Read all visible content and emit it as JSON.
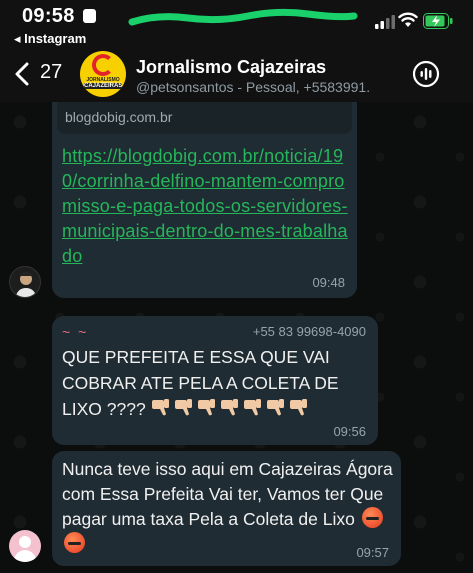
{
  "status_bar": {
    "time": "09:58",
    "back_app_label": "◂ Instagram"
  },
  "header": {
    "unread_count": "27",
    "contact_name": "Jornalismo Cajazeiras",
    "contact_subtitle": "@petsonsantos - Pessoal, +5583991...",
    "avatar_text_top": "JORNALISMO",
    "avatar_text_bottom": "CAJAZEIRAS"
  },
  "messages": [
    {
      "link_domain": "blogdobig.com.br",
      "link_url": "https://blogdobig.com.br/noticia/190/corrinha-delfino-mantem-compromisso-e-paga-todos-os-servidores-municipais-dentro-do-mes-trabalhado",
      "time": "09:48"
    },
    {
      "sender_alias": "~ ~",
      "sender_phone": "+55 83 99698-4090",
      "text": "QUE PREFEITA E ESSA QUE VAI COBRAR ATE PELA A COLETA DE LIXO ????",
      "emoji_icon": "thumbs-down-icon",
      "emoji_count": 7,
      "time": "09:56"
    },
    {
      "text": "Nunca teve isso aqui em Cajazeiras Ágora com Essa Prefeita Vai ter, Vamos ter Que pagar uma taxa Pela a Coleta de Lixo",
      "emoji_icon": "angry-cursing-face-icon",
      "emoji_count": 2,
      "time": "09:57"
    }
  ],
  "colors": {
    "link": "#25b65a",
    "bubble": "#202c33",
    "sender_alias": "#e66a86",
    "battery": "#34c759"
  }
}
